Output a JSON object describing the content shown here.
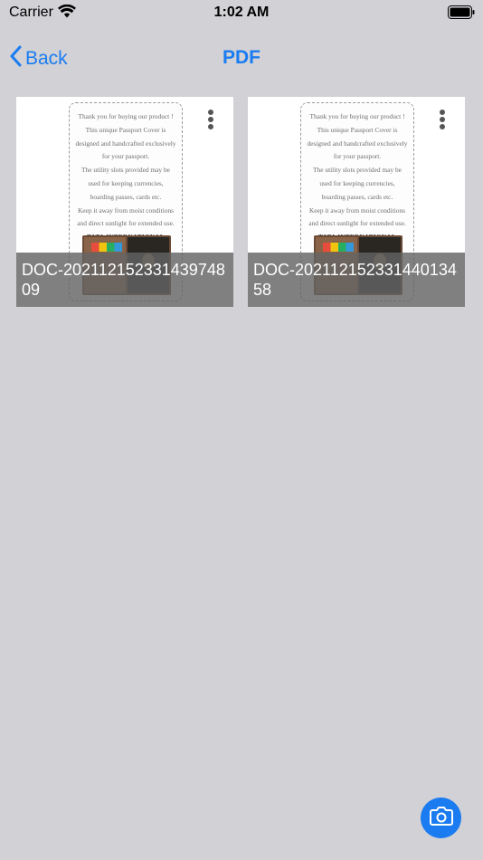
{
  "status_bar": {
    "carrier": "Carrier",
    "time": "1:02 AM"
  },
  "nav": {
    "back_label": "Back",
    "title": "PDF"
  },
  "leaflet": {
    "lines": [
      "Thank you for buying our product !",
      "This unique Passport Cover is",
      "designed and handcrafted exclusively",
      "for your passport.",
      "The utility slots provided may be",
      "used for keeping currencies,",
      "boarding passes, cards etc.",
      "Keep it away from moist conditions",
      "and direct sunlight for extended use."
    ],
    "brand": "TATA INTERNATIONAL"
  },
  "documents": [
    {
      "name": "DOC-20211215233143974809"
    },
    {
      "name": "DOC-20211215233144013458"
    }
  ],
  "colors": {
    "accent": "#1a7cf0",
    "background": "#d1d1d6"
  }
}
